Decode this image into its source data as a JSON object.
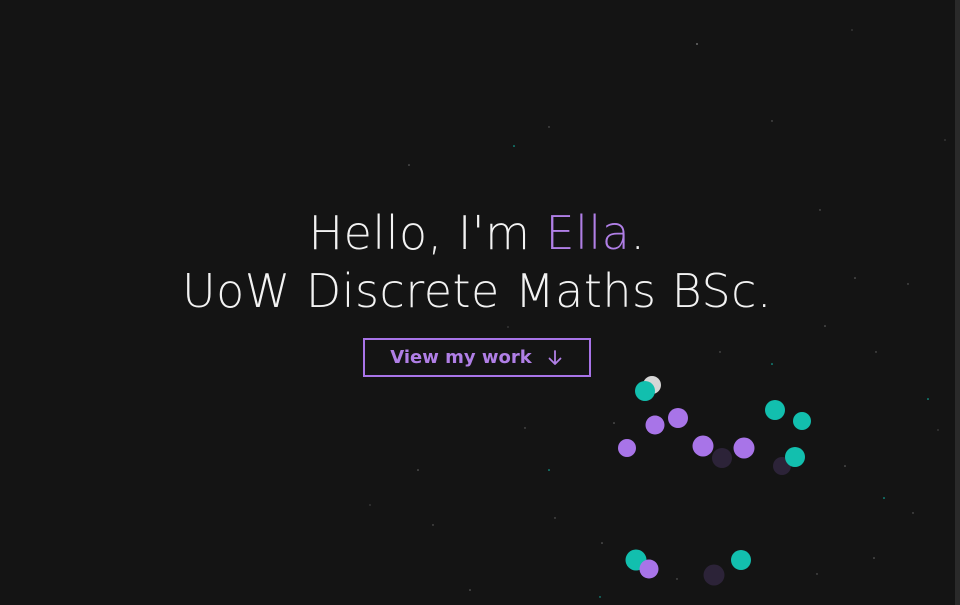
{
  "hero": {
    "greeting": "Hello, I'm ",
    "name": "Ella",
    "period": ".",
    "subtitle": "UoW Discrete Maths BSc."
  },
  "cta": {
    "label": "View my work",
    "icon": "arrow-down-icon"
  },
  "colors": {
    "background": "#141414",
    "accent": "#b07fe6",
    "teal": "#12bfae",
    "text": "#f2f2f2"
  }
}
